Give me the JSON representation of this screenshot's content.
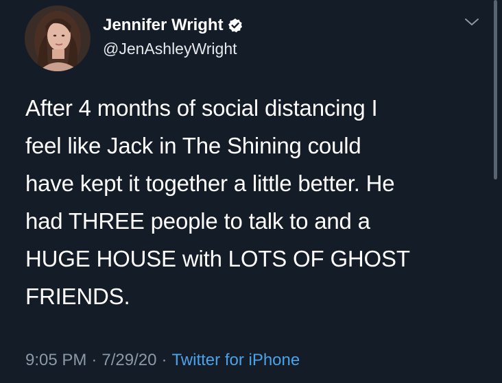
{
  "colors": {
    "background": "#141c28",
    "text": "#ffffff",
    "secondary_text": "#8b98a5",
    "link": "#4aa3e8",
    "verified_badge": "#ffffff"
  },
  "author": {
    "display_name": "Jennifer Wright",
    "handle": "@JenAshleyWright",
    "verified_icon": "verified-badge-icon",
    "avatar_icon": "avatar"
  },
  "tweet": {
    "lines": [
      "After 4 months of social distancing I",
      "feel like Jack in The Shining could",
      "have kept it together a little better. He",
      "had THREE people to talk to and a",
      "HUGE HOUSE with LOTS OF GHOST",
      "FRIENDS."
    ]
  },
  "meta": {
    "time": "9:05 PM",
    "separator": "·",
    "date": "7/29/20",
    "source": "Twitter for iPhone"
  },
  "menu": {
    "icon": "chevron-down-icon"
  }
}
